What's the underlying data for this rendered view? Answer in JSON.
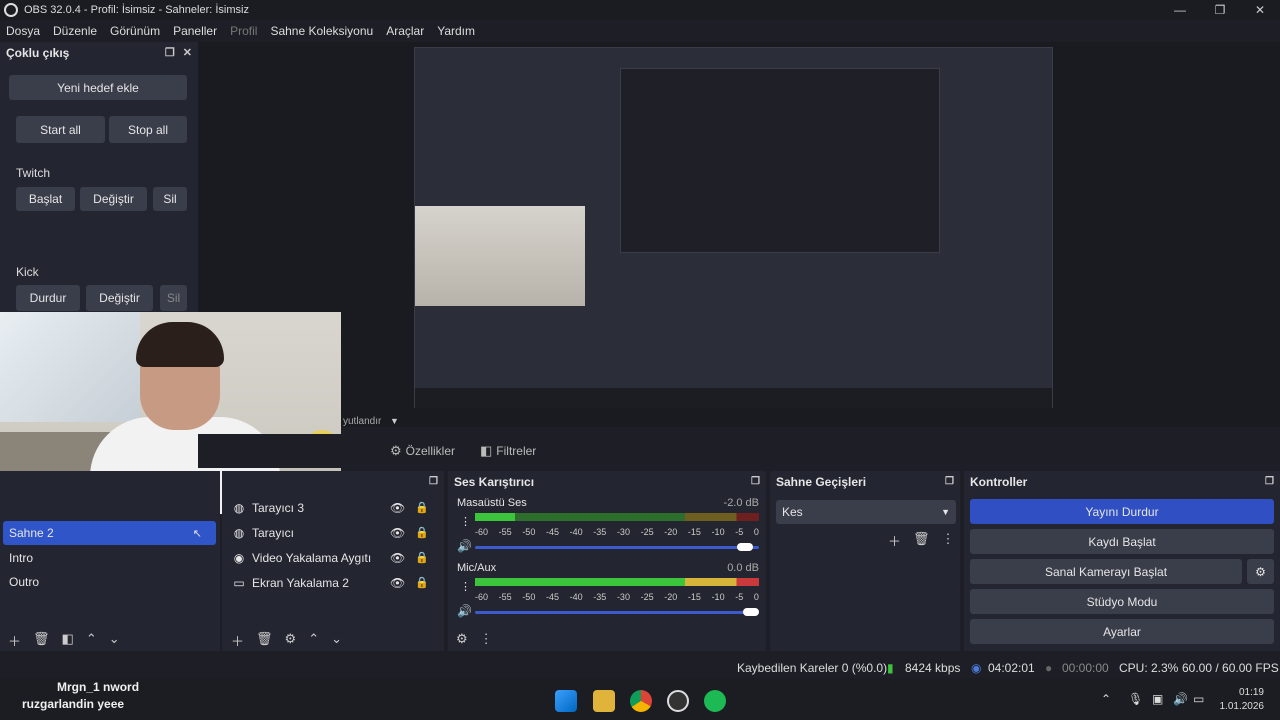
{
  "window": {
    "title": "OBS 32.0.4 - Profil: İsimsiz - Sahneler: İsimsiz",
    "minimize": "—",
    "maximize": "❐",
    "close": "✕"
  },
  "menu": [
    "Dosya",
    "Düzenle",
    "Görünüm",
    "Paneller",
    "Profil",
    "Sahne Koleksiyonu",
    "Araçlar",
    "Yardım"
  ],
  "multi_output": {
    "title": "Çoklu çıkış",
    "add_target": "Yeni hedef ekle",
    "start_all": "Start all",
    "stop_all": "Stop all",
    "twitch": {
      "label": "Twitch",
      "start": "Başlat",
      "edit": "Değiştir",
      "delete": "Sil"
    },
    "kick": {
      "label": "Kick",
      "stop": "Durdur",
      "edit": "Değiştir",
      "delete": "Sil"
    }
  },
  "partial_label": "yutlandır",
  "toolbar": {
    "properties": "Özellikler",
    "filters": "Filtreler"
  },
  "scenes": {
    "items": [
      "Sahne 2",
      "Intro",
      "Outro"
    ]
  },
  "sources": {
    "items": [
      {
        "name": "Tarayıcı 3",
        "icon": "globe-icon"
      },
      {
        "name": "Tarayıcı",
        "icon": "globe-icon"
      },
      {
        "name": "Video Yakalama Aygıtı",
        "icon": "camera-icon"
      },
      {
        "name": "Ekran Yakalama 2",
        "icon": "monitor-icon"
      }
    ]
  },
  "mixer": {
    "title": "Ses Karıştırıcı",
    "channels": [
      {
        "name": "Masaüstü Ses",
        "db": "-2.0 dB"
      },
      {
        "name": "Mic/Aux",
        "db": "0.0 dB"
      }
    ],
    "scale": [
      "-60",
      "-55",
      "-50",
      "-45",
      "-40",
      "-35",
      "-30",
      "-25",
      "-20",
      "-15",
      "-10",
      "-5",
      "0"
    ]
  },
  "transitions": {
    "title": "Sahne Geçişleri",
    "selected": "Kes"
  },
  "controls": {
    "title": "Kontroller",
    "stop_stream": "Yayını Durdur",
    "start_record": "Kaydı Başlat",
    "virtual_cam": "Sanal Kamerayı Başlat",
    "studio_mode": "Stüdyo Modu",
    "settings": "Ayarlar"
  },
  "status": {
    "dropped": "Kaybedilen Kareler 0 (%0.0)",
    "bitrate": "8424 kbps",
    "stream_time": "04:02:01",
    "rec_time": "00:00:00",
    "cpu": "CPU: 2.3%",
    "fps": "60.00 / 60.00 FPS"
  },
  "chat": {
    "line1_user": "Mrgn_1",
    "line1_msg": "nword",
    "line2_user": "ruzgarlandin",
    "line2_msg": "yeee"
  },
  "clock": {
    "time": "01:19",
    "date": "1.01.2026"
  },
  "colors": {
    "accent": "#2f55c9",
    "meter_green": "#3cc43c",
    "meter_yellow": "#d7b53a",
    "meter_red": "#c93a3a"
  }
}
